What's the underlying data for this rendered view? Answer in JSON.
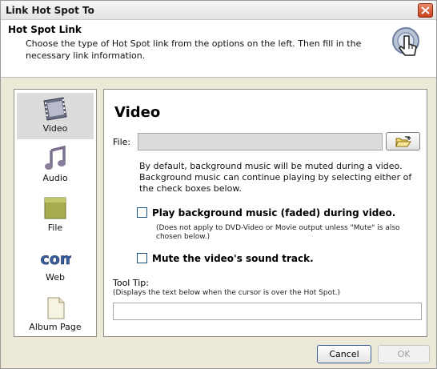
{
  "window": {
    "title": "Link Hot Spot To"
  },
  "header": {
    "title": "Hot Spot Link",
    "description": "Choose the type of Hot Spot link from the options on the left. Then fill in the necessary link information."
  },
  "sidebar": {
    "items": [
      {
        "label": "Video",
        "icon": "film-icon",
        "selected": true
      },
      {
        "label": "Audio",
        "icon": "music-note-icon",
        "selected": false
      },
      {
        "label": "File",
        "icon": "folder-icon",
        "selected": false
      },
      {
        "label": "Web",
        "icon": "web-icon",
        "selected": false
      },
      {
        "label": "Album Page",
        "icon": "page-icon",
        "selected": false
      }
    ]
  },
  "main": {
    "title": "Video",
    "file_label": "File:",
    "file_value": "",
    "info": "By default, background music will be muted during a video. Background music can continue playing by selecting either of the check boxes below.",
    "checkbox1_label": "Play background music (faded) during video.",
    "checkbox1_note": "(Does not apply to DVD-Video or Movie output unless \"Mute\" is also chosen below.)",
    "checkbox2_label": "Mute the video's sound track.",
    "tooltip_label": "Tool Tip:",
    "tooltip_note": "(Displays the text below when the cursor is over the Hot Spot.)",
    "tooltip_value": ""
  },
  "buttons": {
    "cancel": "Cancel",
    "ok": "OK"
  },
  "colors": {
    "dialog_bg": "#ece9d8",
    "close_red": "#c9411c",
    "button_border_blue": "#3b5e8f"
  }
}
